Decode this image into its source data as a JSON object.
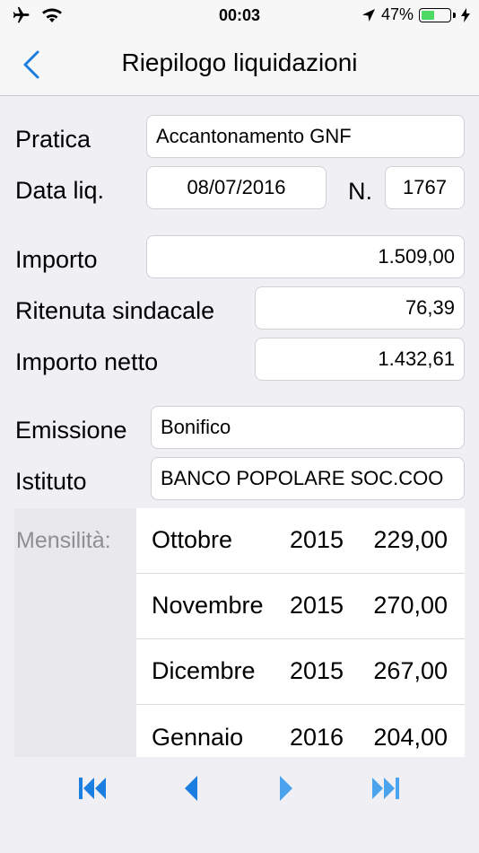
{
  "status_bar": {
    "time": "00:03",
    "battery": "47%",
    "battery_level": 0.47,
    "icons": [
      "airplane-icon",
      "wifi-icon",
      "location-icon",
      "charging-icon"
    ]
  },
  "nav": {
    "title": "Riepilogo liquidazioni",
    "back_icon": "chevron-left-icon"
  },
  "form": {
    "pratica_label": "Pratica",
    "pratica_value": "Accantonamento GNF",
    "data_label": "Data liq.",
    "data_value": "08/07/2016",
    "n_label": "N.",
    "n_value": "1767",
    "importo_label": "Importo",
    "importo_value": "1.509,00",
    "ritenuta_label": "Ritenuta sindacale",
    "ritenuta_value": "76,39",
    "netto_label": "Importo netto",
    "netto_value": "1.432,61",
    "emissione_label": "Emissione",
    "emissione_value": "Bonifico",
    "istituto_label": "Istituto",
    "istituto_value": "BANCO POPOLARE SOC.COO"
  },
  "mensilita": {
    "label": "Mensilità:",
    "rows": [
      {
        "month": "Ottobre",
        "year": "2015",
        "amount": "229,00"
      },
      {
        "month": "Novembre",
        "year": "2015",
        "amount": "270,00"
      },
      {
        "month": "Dicembre",
        "year": "2015",
        "amount": "267,00"
      },
      {
        "month": "Gennaio",
        "year": "2016",
        "amount": "204,00"
      }
    ]
  },
  "toolbar": {
    "accent": "#1a7fe0",
    "icons": [
      "first-record-icon",
      "previous-record-icon",
      "next-record-icon",
      "last-record-icon"
    ]
  }
}
